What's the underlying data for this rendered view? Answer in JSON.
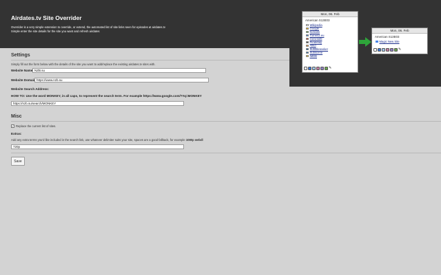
{
  "header": {
    "title": "Airdates.tv Site Overrider",
    "description_line1": "Overrider is a very simple extension to override, or extend, the automated list of site links seen for episodes at airdates.tv",
    "description_line2": "Simple enter the site details for the site you want and refresh airdates"
  },
  "preview": {
    "left_card": {
      "date": "Mon, 06. Feb",
      "show": "American S13E03",
      "sites": [
        {
          "name": "Wikipedia",
          "color": "#ffffff"
        },
        {
          "name": "Google",
          "color": "#f4b400"
        },
        {
          "name": "Kickass",
          "color": "#6aa84f"
        },
        {
          "name": "Torrentz.eu",
          "color": "#3c78d8"
        },
        {
          "name": "Generalfil",
          "color": "#cc4125"
        },
        {
          "name": "Piratebay",
          "color": "#444444"
        },
        {
          "name": "Allkd",
          "color": "#e69138"
        },
        {
          "name": "Subtitleseeker",
          "color": "#0b5394"
        },
        {
          "name": "Subscene",
          "color": "#2f6fb0"
        },
        {
          "name": "IMDB",
          "color": "#f1c232"
        }
      ],
      "dots": [
        "#ffffff",
        "#3c78d8",
        "#9fc5e8",
        "#c27ba0",
        "#8e7cc3",
        "#6aa84f"
      ]
    },
    "right_card": {
      "date": "Mon, 06. Feb",
      "show": "American S13E03",
      "site": "Magic New Site",
      "dots": [
        "#ffffff",
        "#3c78d8",
        "#9fc5e8",
        "#c27ba0",
        "#8e7cc3",
        "#6aa84f"
      ]
    },
    "arrow_color": "#2ea53a"
  },
  "settings": {
    "title": "Settings",
    "intro": "Simply fill out the form below with the details of the site you want to add/replace the existing airdates.tv sites with.",
    "website_name_label": "Website Name:",
    "website_name_value": "NZB.su",
    "website_domain_label": "Website Domain:",
    "website_domain_value": "https://www.nzb.su",
    "search_address_label": "Website Search Address:",
    "how_to": "HOW TO: Use the word MONKEY, in all caps, to represent the search term. For example https://www.google.com/?#q=MONKEY",
    "search_address_value": "https://nzb.su/search/MONKEY"
  },
  "misc": {
    "title": "Misc",
    "replace_label": "Replace the current list of sites.",
    "extras_label": "Extras:",
    "extras_desc_prefix": "Add any extra terms you'd like included in the search link, use whatever delimiter suits your site, spaces are a good fallback, for example ",
    "extras_desc_example": "1080p webdl",
    "extras_value": "720p"
  },
  "footer": {
    "save_label": "Save"
  }
}
